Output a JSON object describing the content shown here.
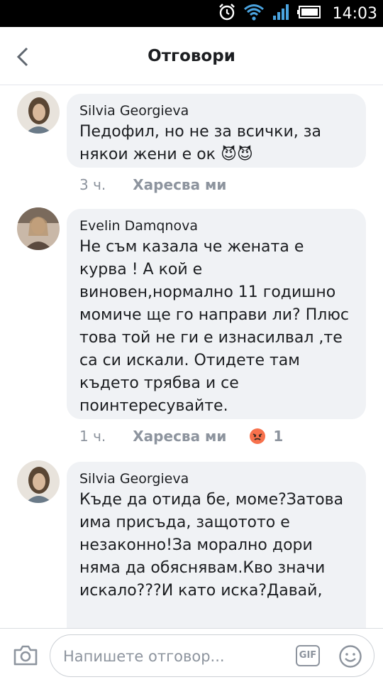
{
  "status_bar": {
    "time": "14:03",
    "icons": [
      "alarm-icon",
      "wifi-icon",
      "signal-icon",
      "battery-icon"
    ]
  },
  "header": {
    "title": "Отговори",
    "back_icon": "chevron-left-icon"
  },
  "comments": [
    {
      "author": "Silvia Georgieva",
      "text": "Педофил, но не за всички, за някои жени е ок 😈😈",
      "time": "3 ч.",
      "like_label": "Харесва ми"
    },
    {
      "author": "Evelin Damqnova",
      "text": "Не съм казала че жената е курва ! А кой е виновен,нормално 11 годишно момиче ще го направи ли? Плюс това той не ги е изнасилвал ,те са си искали. Отидете там където трябва и се поинтересувайте.",
      "time": "1 ч.",
      "like_label": "Харесва ми",
      "reaction": {
        "icon": "angry-reaction-icon",
        "count": "1",
        "color": "#f7714c"
      }
    },
    {
      "author": "Silvia Georgieva",
      "text": "Къде да отида бе, моме?Затова има присъда, защотото е незаконно!За морално дори няма да обяснявам.Кво значи искало???И като иска?Давай,"
    }
  ],
  "composer": {
    "placeholder": "Напишете отговор...",
    "gif_label": "GIF",
    "camera_icon": "camera-icon",
    "emoji_icon": "smiley-icon"
  },
  "colors": {
    "bubble": "#f0f2f5",
    "meta_text": "#8d949e",
    "primary_text": "#1c1e21"
  }
}
